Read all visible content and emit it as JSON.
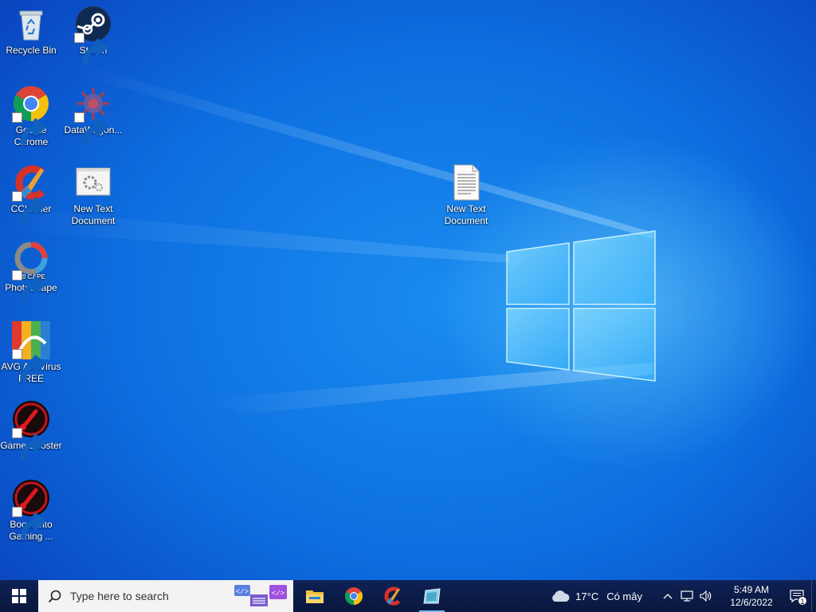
{
  "desktop": {
    "icons": [
      {
        "id": "recycle-bin",
        "label": "Recycle Bin",
        "icon": "recycle-bin-icon",
        "shortcut": false
      },
      {
        "id": "steam",
        "label": "Steam",
        "icon": "steam-icon",
        "shortcut": true
      },
      {
        "id": "google-chrome",
        "label": "Google Chrome",
        "icon": "chrome-icon",
        "shortcut": true
      },
      {
        "id": "datawagon",
        "label": "DataWagon...",
        "icon": "datawagon-icon",
        "shortcut": true
      },
      {
        "id": "ccleaner",
        "label": "CCleaner",
        "icon": "ccleaner-icon",
        "shortcut": true
      },
      {
        "id": "new-text-document-1",
        "label": "New Text Document",
        "icon": "settings-file-icon",
        "shortcut": false
      },
      {
        "id": "photoscape",
        "label": "PhotoScape",
        "icon": "photoscape-icon",
        "shortcut": true
      },
      {
        "id": "avg-antivirus",
        "label": "AVG AntiVirus FREE",
        "icon": "avg-icon",
        "shortcut": true
      },
      {
        "id": "game-booster",
        "label": "Game Booster",
        "icon": "game-booster-icon",
        "shortcut": true
      },
      {
        "id": "boost-into-gaming",
        "label": "Boost into Gaming ...",
        "icon": "game-booster-icon",
        "shortcut": true
      },
      {
        "id": "new-text-document-2",
        "label": "New Text Document",
        "icon": "text-document-icon",
        "shortcut": false
      }
    ]
  },
  "taskbar": {
    "search_placeholder": "Type here to search",
    "apps": [
      {
        "name": "File Explorer",
        "icon": "file-explorer-icon",
        "active": false
      },
      {
        "name": "Google Chrome",
        "icon": "chrome-icon",
        "active": false
      },
      {
        "name": "CCleaner",
        "icon": "ccleaner-icon",
        "active": false
      },
      {
        "name": "Unknown app",
        "icon": "app-window-icon",
        "active": true
      }
    ],
    "weather": {
      "temp": "17°C",
      "condition": "Có mây",
      "icon": "cloud-icon"
    },
    "clock": {
      "time": "5:49 AM",
      "date": "12/6/2022"
    },
    "notification_count": "1"
  },
  "colors": {
    "taskbar": "#0b1a44",
    "wallpaper_blue": "#0d6fe0",
    "search_bg": "#f3f3f3"
  }
}
